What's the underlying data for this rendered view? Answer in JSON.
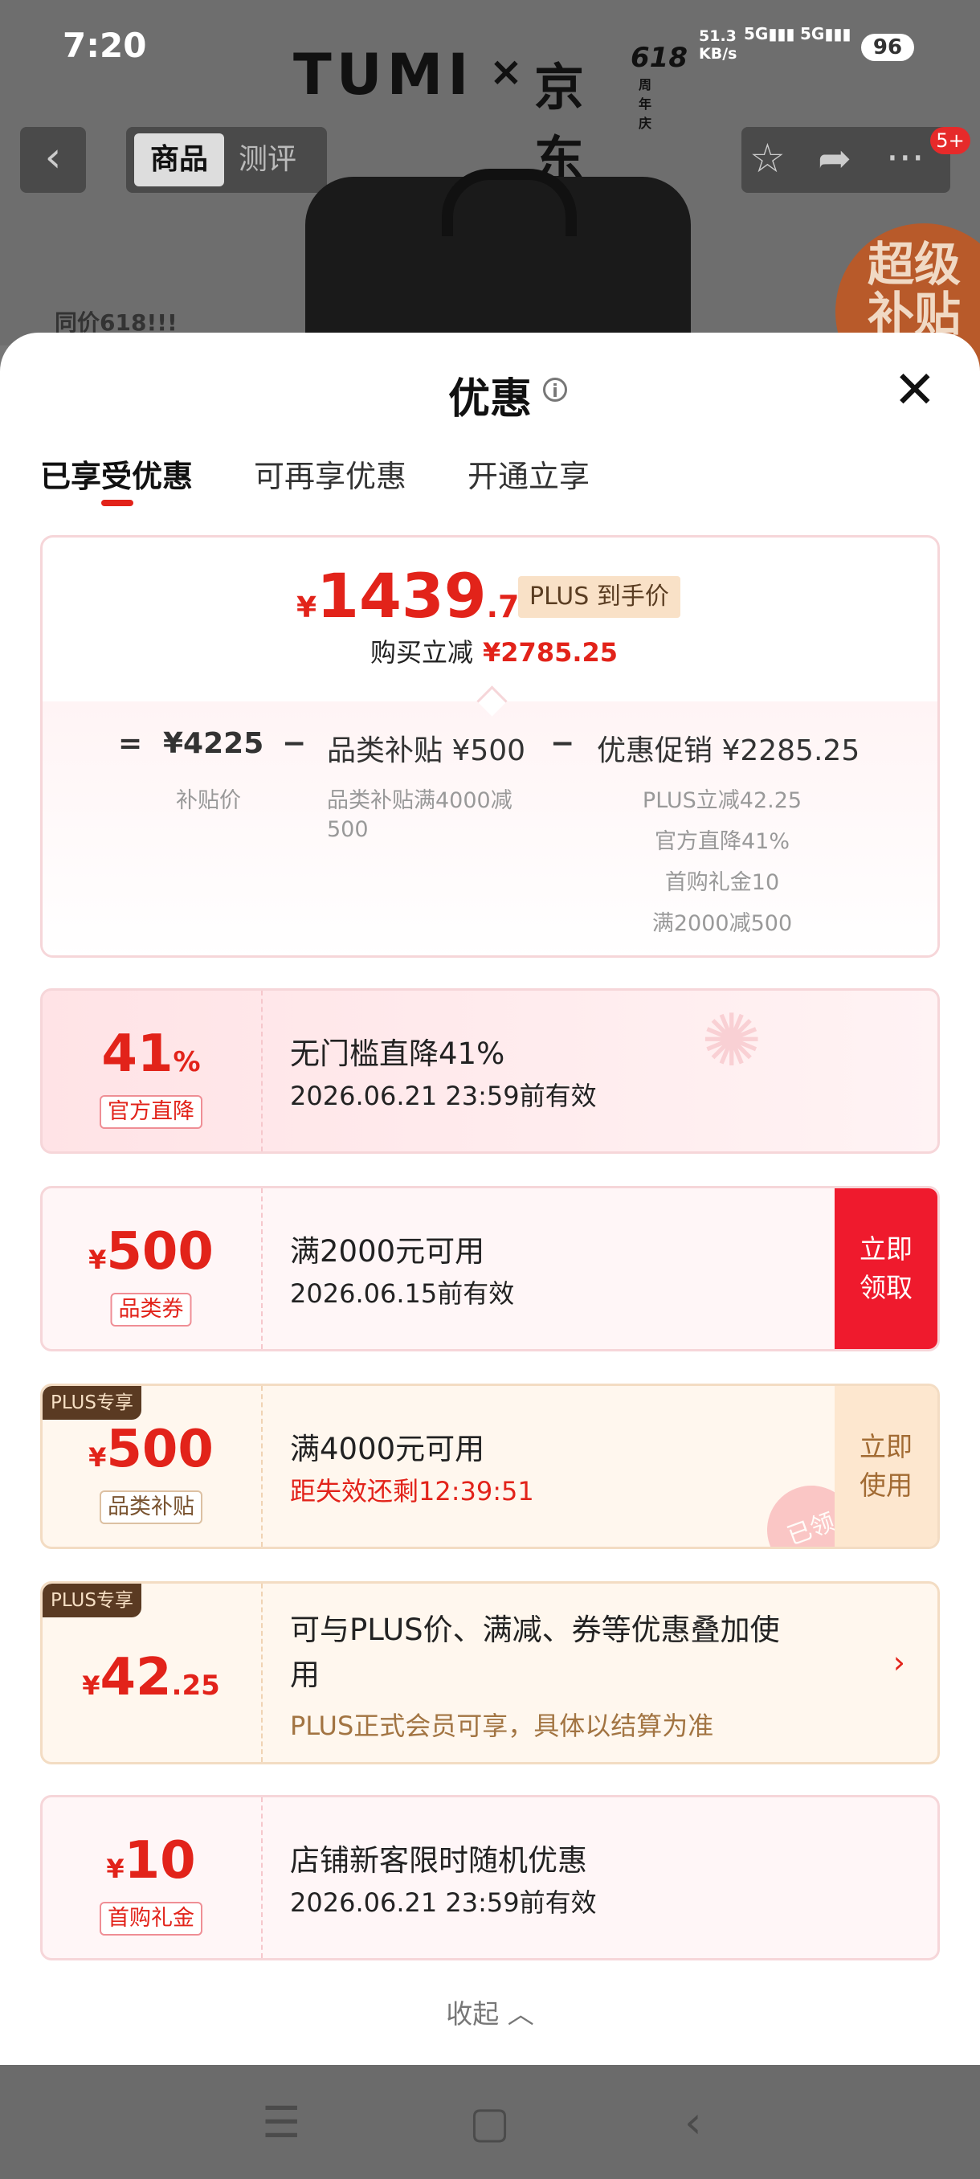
{
  "status": {
    "time": "7:20",
    "speed_top": "51.3",
    "speed_unit": "KB/s",
    "sig1": "5G",
    "sig2": "5G",
    "battery": "96"
  },
  "brand": {
    "tumi": "TUMI",
    "x": "×",
    "jd": "京东",
    "anniv": "618",
    "anniv_sub": "周年庆"
  },
  "nav": {
    "back": "‹",
    "tab_goods": "商品",
    "tab_review": "测评",
    "badge": "5+"
  },
  "promo": {
    "plus_tag": "PLUS 超级补贴",
    "circle": "超级 补贴",
    "same_price": "同价618!!!"
  },
  "sheet": {
    "title": "优惠",
    "info": "i",
    "close": "✕",
    "tabs": [
      "已享受优惠",
      "可再享优惠",
      "开通立享"
    ],
    "summary": {
      "yen": "¥",
      "price_int": "1439",
      "price_dec": ".75",
      "plus_label": "PLUS 到手价",
      "buy_label": "购买立减",
      "buy_amount": "¥2785.25",
      "eq": "=",
      "base": "¥4225",
      "minus1": "−",
      "cat_sub": "品类补贴 ¥500",
      "minus2": "−",
      "promo": "优惠促销 ¥2285.25",
      "base_label": "补贴价",
      "cat_label_1": "品类补贴满4000减",
      "cat_label_2": "500",
      "promo_items": [
        "PLUS立减42.25",
        "官方直降41%",
        "首购礼金10",
        "满2000减500"
      ]
    },
    "cards": [
      {
        "num": "41",
        "pct": "%",
        "tag": "官方直降",
        "l1": "无门槛直降41%",
        "l2": "2026.06.21 23:59前有效"
      },
      {
        "yen": "¥",
        "num": "500",
        "tag": "品类券",
        "l1": "满2000元可用",
        "l2": "2026.06.15前有效",
        "btn1": "立即",
        "btn2": "领取"
      },
      {
        "badge": "PLUS专享",
        "yen": "¥",
        "num": "500",
        "tag": "品类补贴",
        "l1": "满4000元可用",
        "l2": "距失效还剩12:39:51",
        "btn1": "立即",
        "btn2": "使用",
        "stamp": "已领"
      },
      {
        "badge": "PLUS专享",
        "yen": "¥",
        "num": "42",
        "dec": ".25",
        "l1a": "可与PLUS价、满减、券等优惠叠加使",
        "l1b": "用",
        "l2": "PLUS正式会员可享，具体以结算为准",
        "chev": "›"
      },
      {
        "yen": "¥",
        "num": "10",
        "tag": "首购礼金",
        "l1": "店铺新客限时随机优惠",
        "l2": "2026.06.21 23:59前有效"
      }
    ],
    "collapse": "收起 ︿"
  },
  "navbar": {
    "menu": "☰",
    "home": "▢",
    "back": "‹"
  }
}
